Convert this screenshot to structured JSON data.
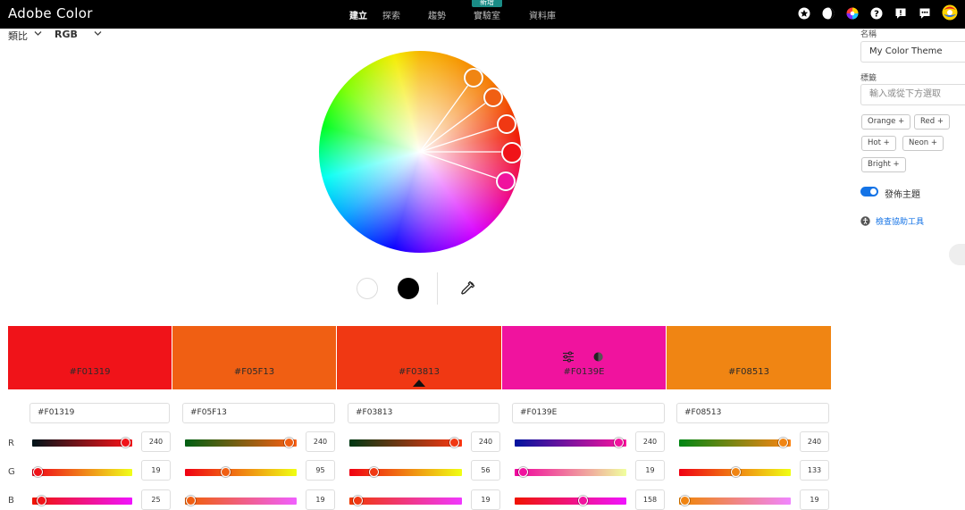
{
  "app": {
    "title": "Adobe Color"
  },
  "nav": {
    "create": "建立",
    "explore": "探索",
    "trends": "趨勢",
    "labs": "實驗室",
    "labs_badge": "新增",
    "library": "資料庫"
  },
  "top_icons": [
    "star-icon",
    "moon-icon",
    "color-wheel-icon",
    "help-icon",
    "alert-icon",
    "chat-icon",
    "user-avatar-icon"
  ],
  "controls": {
    "harmony": "類比",
    "mode": "RGB"
  },
  "wheel_icons": [
    "eyedropper-icon"
  ],
  "swatches": [
    {
      "hex": "#F01319",
      "color": "#F01319"
    },
    {
      "hex": "#F05F13",
      "color": "#F05F13"
    },
    {
      "hex": "#F03813",
      "color": "#F03813"
    },
    {
      "hex": "#F0139E",
      "color": "#F0139E"
    },
    {
      "hex": "#F08513",
      "color": "#F08513"
    }
  ],
  "swatch_icons": [
    "sliders-icon",
    "contrast-icon"
  ],
  "channels": {
    "r": "R",
    "g": "G",
    "b": "B"
  },
  "values": [
    {
      "r": "240",
      "g": "19",
      "b": "25"
    },
    {
      "r": "240",
      "g": "95",
      "b": "19"
    },
    {
      "r": "240",
      "g": "56",
      "b": "19"
    },
    {
      "r": "240",
      "g": "19",
      "b": "158"
    },
    {
      "r": "240",
      "g": "133",
      "b": "19"
    }
  ],
  "sidebar": {
    "name_label": "名稱",
    "name_value": "My Color Theme",
    "tags_label": "標籤",
    "tags_placeholder": "輸入或從下方選取",
    "tags": [
      "Orange +",
      "Red +",
      "Hot +",
      "Neon +",
      "Bright +"
    ],
    "publish_label": "發佈主題",
    "accessibility_label": "檢查協助工具"
  },
  "colors": {
    "accent": "#1473E6",
    "badge": "#1A8C86"
  }
}
